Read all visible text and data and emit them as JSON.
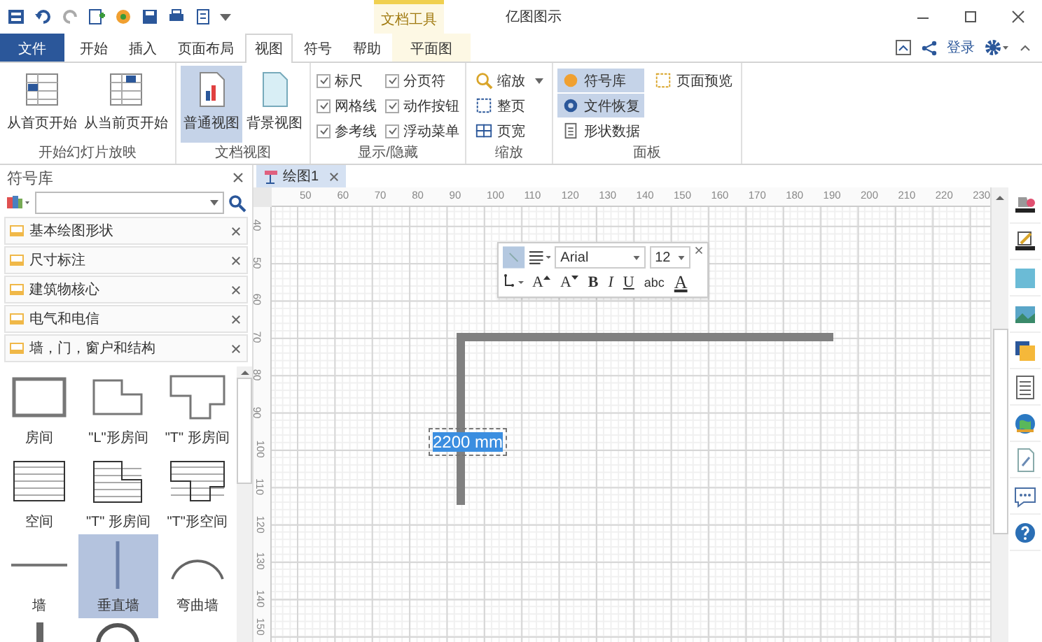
{
  "window": {
    "title": "亿图图示",
    "context_tab_group": "文档工具"
  },
  "ribbon_tabs": [
    {
      "label": "文件",
      "kind": "file",
      "selected": false
    },
    {
      "label": "开始",
      "kind": "normal",
      "selected": false
    },
    {
      "label": "插入",
      "kind": "normal",
      "selected": false
    },
    {
      "label": "页面布局",
      "kind": "normal",
      "selected": false
    },
    {
      "label": "视图",
      "kind": "normal",
      "selected": true
    },
    {
      "label": "符号",
      "kind": "normal",
      "selected": false
    },
    {
      "label": "帮助",
      "kind": "normal",
      "selected": false
    },
    {
      "label": "平面图",
      "kind": "context",
      "selected": false
    }
  ],
  "account": {
    "login": "登录"
  },
  "ribbon_groups": [
    {
      "label": "开始幻灯片放映",
      "items": [
        {
          "kind": "large",
          "label": "从首页开始",
          "selected": false
        },
        {
          "kind": "large",
          "label": "从当前页开始",
          "selected": false
        }
      ]
    },
    {
      "label": "文档视图",
      "items": [
        {
          "kind": "large",
          "label": "普通视图",
          "selected": true
        },
        {
          "kind": "large",
          "label": "背景视图",
          "selected": false
        }
      ]
    },
    {
      "label": "显示/隐藏",
      "items": [
        {
          "kind": "checkbox",
          "label": "标尺",
          "checked": true
        },
        {
          "kind": "checkbox",
          "label": "网格线",
          "checked": true
        },
        {
          "kind": "checkbox",
          "label": "参考线",
          "checked": true
        },
        {
          "kind": "checkbox",
          "label": "分页符",
          "checked": true
        },
        {
          "kind": "checkbox",
          "label": "动作按钮",
          "checked": true
        },
        {
          "kind": "checkbox",
          "label": "浮动菜单",
          "checked": true
        }
      ]
    },
    {
      "label": "缩放",
      "items": [
        {
          "kind": "small",
          "label": "缩放",
          "dropdown": true,
          "selected": false
        },
        {
          "kind": "small",
          "label": "整页",
          "dropdown": false,
          "selected": false
        },
        {
          "kind": "small",
          "label": "页宽",
          "dropdown": false,
          "selected": false
        }
      ]
    },
    {
      "label": "面板",
      "items": [
        {
          "kind": "small",
          "label": "符号库",
          "dropdown": false,
          "selected": true
        },
        {
          "kind": "small",
          "label": "文件恢复",
          "dropdown": false,
          "selected": true
        },
        {
          "kind": "small",
          "label": "形状数据",
          "dropdown": false,
          "selected": false
        },
        {
          "kind": "small",
          "label": "页面预览",
          "dropdown": false,
          "selected": false
        }
      ]
    }
  ],
  "symbol_panel": {
    "title": "符号库",
    "libraries": [
      {
        "label": "基本绘图形状"
      },
      {
        "label": "尺寸标注"
      },
      {
        "label": "建筑物核心"
      },
      {
        "label": "电气和电信"
      },
      {
        "label": "墙，门，窗户和结构"
      }
    ],
    "shapes": [
      {
        "kind": "room",
        "label": "房间",
        "selected": false
      },
      {
        "kind": "l-room",
        "label": "\"L\"形房间",
        "selected": false
      },
      {
        "kind": "t-room",
        "label": "\"T\" 形房间",
        "selected": false
      },
      {
        "kind": "space",
        "label": "空间",
        "selected": false
      },
      {
        "kind": "l-space",
        "label": "\"T\" 形房间",
        "selected": false
      },
      {
        "kind": "t-space",
        "label": "\"T\"形空间",
        "selected": false
      },
      {
        "kind": "wall",
        "label": "墙",
        "selected": false
      },
      {
        "kind": "vertical-wall",
        "label": "垂直墙",
        "selected": true
      },
      {
        "kind": "curved-wall",
        "label": "弯曲墙",
        "selected": false
      },
      {
        "kind": "column",
        "selected": false
      },
      {
        "kind": "arc",
        "selected": false
      }
    ]
  },
  "document_tabs": [
    {
      "label": "绘图1",
      "selected": true
    }
  ],
  "rulers": {
    "horizontal": [
      "50",
      "60",
      "70",
      "80",
      "90",
      "100",
      "110",
      "120",
      "130",
      "140",
      "150",
      "160",
      "170",
      "180",
      "190",
      "200",
      "210",
      "220",
      "230"
    ],
    "vertical": [
      "40",
      "50",
      "60",
      "70",
      "80",
      "90",
      "100",
      "110",
      "120",
      "130",
      "140",
      "150"
    ]
  },
  "canvas": {
    "dimension_label": {
      "text": "2200 mm",
      "selected": true
    }
  },
  "floating_toolbar": {
    "font": "Arial",
    "size": "12",
    "buttons": [
      {
        "kind": "grow",
        "glyph": "A"
      },
      {
        "kind": "shrink",
        "glyph": "A"
      },
      {
        "kind": "bold",
        "glyph": "B"
      },
      {
        "kind": "italic",
        "glyph": "I"
      },
      {
        "kind": "underline",
        "glyph": "U"
      },
      {
        "kind": "strike",
        "glyph": "abc"
      },
      {
        "kind": "color",
        "glyph": "A"
      }
    ]
  }
}
